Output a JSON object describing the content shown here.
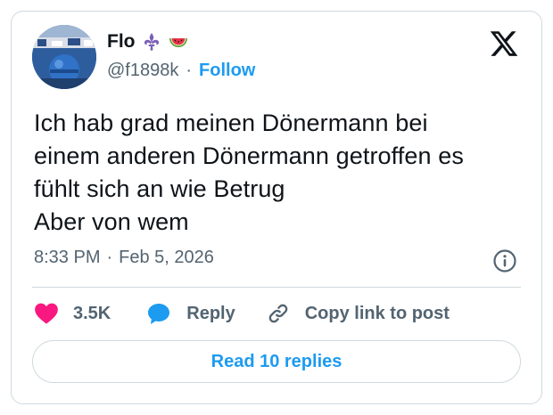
{
  "author": {
    "display_name": "Flo",
    "handle": "@f1898k",
    "separator": "·",
    "follow_label": "Follow",
    "badges": [
      "fleur-de-lis-icon",
      "watermelon-icon"
    ]
  },
  "tweet": {
    "text": "Ich hab grad meinen Dönermann bei\neinem anderen Dönermann getroffen es\nfühlt sich an wie Betrug\nAber von wem",
    "time": "8:33 PM",
    "separator": "·",
    "date": "Feb 5, 2026"
  },
  "actions": {
    "like_count": "3.5K",
    "reply_label": "Reply",
    "copy_link_label": "Copy link to post"
  },
  "read_replies_label": "Read 10 replies",
  "colors": {
    "accent": "#1d9bf0",
    "like": "#f91880",
    "text": "#0f1419",
    "secondary": "#536471",
    "border": "#cfd9de"
  }
}
